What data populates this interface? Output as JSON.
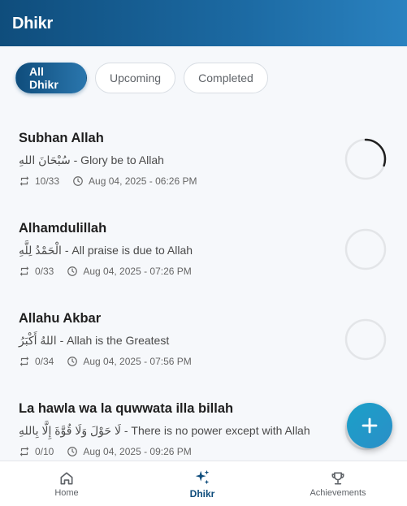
{
  "header": {
    "title": "Dhikr"
  },
  "filters": [
    {
      "label": "All Dhikr",
      "active": true
    },
    {
      "label": "Upcoming",
      "active": false
    },
    {
      "label": "Completed",
      "active": false
    }
  ],
  "items": [
    {
      "name": "Subhan Allah",
      "description": "سُبْحَانَ اللهِ - Glory be to Allah",
      "count": "10/33",
      "datetime": "Aug 04, 2025 - 06:26 PM",
      "progress": 0.303
    },
    {
      "name": "Alhamdulillah",
      "description": "الْحَمْدُ لِلَّهِ - All praise is due to Allah",
      "count": "0/33",
      "datetime": "Aug 04, 2025 - 07:26 PM",
      "progress": 0
    },
    {
      "name": "Allahu Akbar",
      "description": "اللهُ أَكْبَرُ - Allah is the Greatest",
      "count": "0/34",
      "datetime": "Aug 04, 2025 - 07:56 PM",
      "progress": 0
    },
    {
      "name": "La hawla wa la quwwata illa billah",
      "description": "لَا حَوْلَ وَلَا قُوَّةَ إِلَّا بِاللهِ - There is no power except with Allah",
      "count": "0/10",
      "datetime": "Aug 04, 2025 - 09:26 PM",
      "progress": 0
    }
  ],
  "fab": {
    "icon": "plus-icon"
  },
  "bottom_nav": [
    {
      "label": "Home",
      "icon": "home-icon",
      "active": false
    },
    {
      "label": "Dhikr",
      "icon": "sparkles-icon",
      "active": true
    },
    {
      "label": "Achievements",
      "icon": "trophy-icon",
      "active": false
    }
  ],
  "colors": {
    "primary": "#0f4d7c",
    "accent": "#1aa0c9",
    "ring_track": "#e3e5e8",
    "ring_progress": "#1f1f1f"
  }
}
